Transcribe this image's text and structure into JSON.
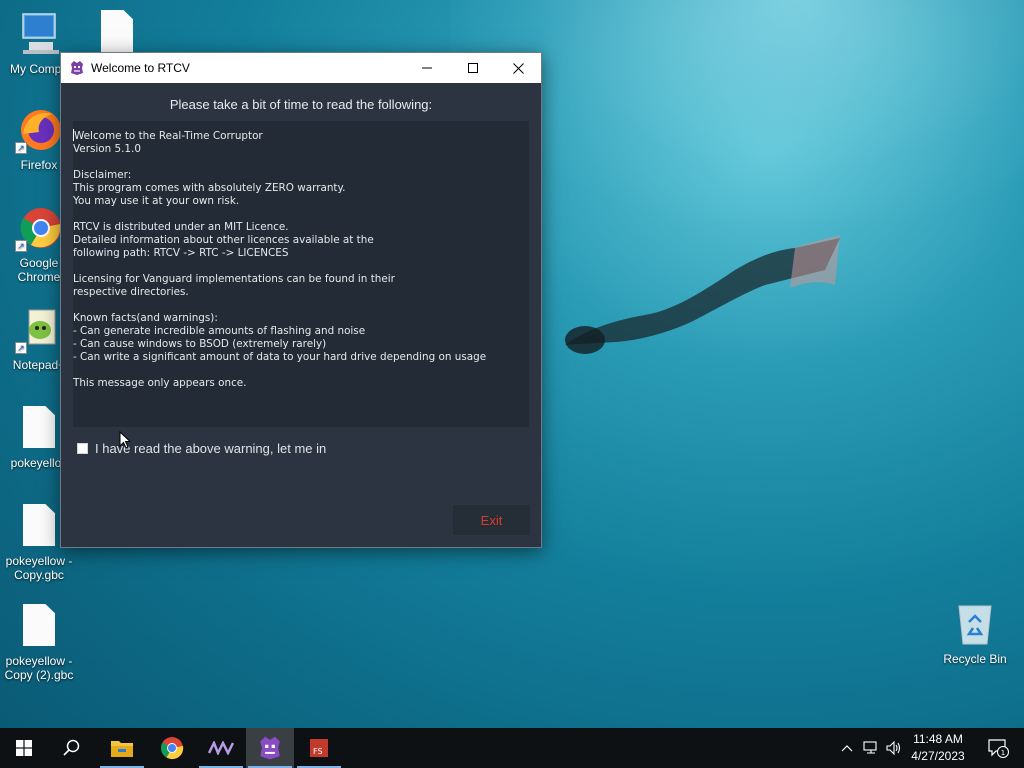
{
  "desktop": {
    "icons": [
      {
        "label": "My Compu",
        "type": "computer"
      },
      {
        "label": "",
        "type": "file"
      },
      {
        "label": "Firefox",
        "type": "firefox"
      },
      {
        "label": "Google Chrome",
        "line1": "Google",
        "line2": "Chrome",
        "type": "chrome"
      },
      {
        "label": "Notepad+",
        "type": "notepad"
      },
      {
        "label": "pokeyellov",
        "type": "file"
      },
      {
        "label": "pokeyellow - Copy.gbc",
        "line1": "pokeyellow -",
        "line2": "Copy.gbc",
        "type": "file"
      },
      {
        "label": "pokeyellow - Copy (2).gbc",
        "line1": "pokeyellow -",
        "line2": "Copy (2).gbc",
        "type": "file"
      },
      {
        "label": "Recycle Bin",
        "type": "recycle-bin"
      }
    ]
  },
  "window": {
    "title": "Welcome to RTCV",
    "heading": "Please take a bit of time to read the following:",
    "body_lines": [
      "Welcome to the Real-Time Corruptor",
      "Version 5.1.0",
      "",
      "Disclaimer:",
      "This program comes with absolutely ZERO warranty.",
      "You may use it at your own risk.",
      "",
      "RTCV is distributed under an MIT Licence.",
      "Detailed information about other licences available at the",
      "following path: RTCV -> RTC -> LICENCES",
      "",
      "Licensing for Vanguard implementations can be found in their",
      "respective directories.",
      "",
      "Known facts(and warnings):",
      "- Can generate incredible amounts of flashing and noise",
      "- Can cause windows to BSOD (extremely rarely)",
      "- Can write a significant amount of data to your hard drive depending on usage",
      "",
      "This message only appears once."
    ],
    "checkbox_label": "I have read the above warning, let me in",
    "checkbox_checked": false,
    "exit_label": "Exit",
    "controls": [
      "minimize-icon",
      "maximize-icon",
      "close-icon"
    ]
  },
  "taskbar": {
    "items": [
      "start-icon",
      "search-icon",
      "file-explorer-icon",
      "chrome-icon",
      "vanguard-icon",
      "rtcv-icon",
      "fs-icon"
    ],
    "active_item": "rtcv-icon",
    "time": "11:48 AM",
    "date": "4/27/2023",
    "notification_count": "1"
  },
  "colors": {
    "window_bg": "#2b3440",
    "textbox_bg": "#232c36",
    "exit_text": "#d63b2e",
    "taskbar_bg": "#0d1114"
  }
}
